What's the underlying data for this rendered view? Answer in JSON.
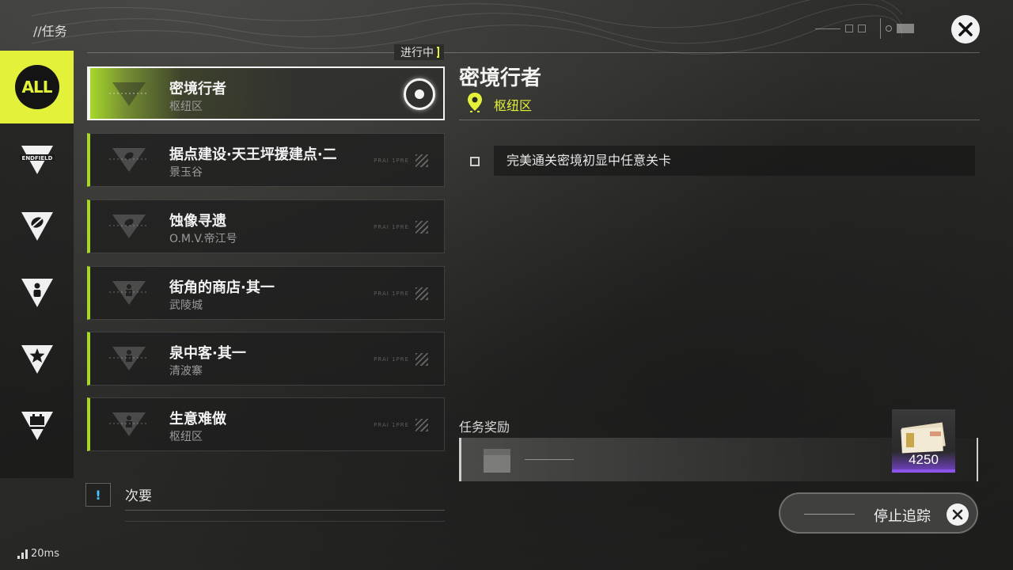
{
  "header": {
    "title": "//任务",
    "status_tag": "进行中"
  },
  "sidebar": {
    "items": [
      {
        "key": "all",
        "label": "ALL",
        "icon": "all-icon",
        "active": true
      },
      {
        "key": "endfield",
        "icon": "endfield-icon",
        "active": false
      },
      {
        "key": "leaf",
        "icon": "leaf-icon",
        "active": false
      },
      {
        "key": "person",
        "icon": "person-icon",
        "active": false
      },
      {
        "key": "star",
        "icon": "star-icon",
        "active": false
      },
      {
        "key": "bag",
        "icon": "bag-icon",
        "active": false
      }
    ]
  },
  "quests": [
    {
      "name": "密境行者",
      "location": "枢纽区",
      "selected": true,
      "tracked": true
    },
    {
      "name": "据点建设·天王坪援建点·二",
      "location": "景玉谷",
      "selected": false
    },
    {
      "name": "蚀像寻遗",
      "location": "O.M.V.帝江号",
      "selected": false
    },
    {
      "name": "街角的商店·其一",
      "location": "武陵城",
      "selected": false
    },
    {
      "name": "泉中客·其一",
      "location": "清波寨",
      "selected": false
    },
    {
      "name": "生意难做",
      "location": "枢纽区",
      "selected": false
    }
  ],
  "secondary": {
    "label": "次要",
    "icon_glyph": "!"
  },
  "detail": {
    "title": "密境行者",
    "location": "枢纽区",
    "objectives": [
      {
        "text": "完美通关密境初显中任意关卡"
      }
    ],
    "reward_label": "任务奖励",
    "reward_item": {
      "count": "4250",
      "icon": "money-bundle-icon"
    }
  },
  "stop_tracking": {
    "label": "停止追踪"
  },
  "network": {
    "ping": "20ms"
  },
  "colors": {
    "accent": "#e3f13a",
    "quest_green": "#a6d82a",
    "rarity_purple": "#8a55e8"
  }
}
